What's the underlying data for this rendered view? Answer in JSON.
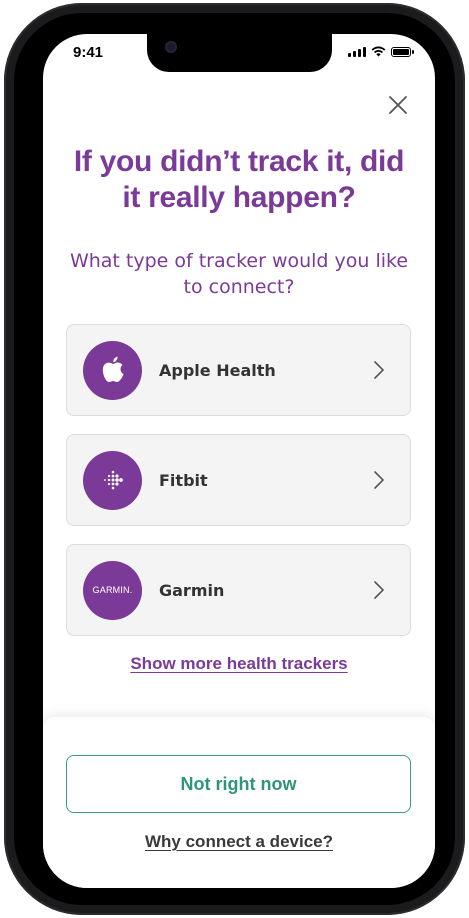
{
  "status_bar": {
    "time": "9:41"
  },
  "headline": "If you didn’t track it, did it really happen?",
  "subheadline": "What type of tracker would you like to connect?",
  "trackers": [
    {
      "name": "Apple Health",
      "icon": "apple-icon"
    },
    {
      "name": "Fitbit",
      "icon": "fitbit-icon"
    },
    {
      "name": "Garmin",
      "icon": "garmin-logo",
      "logo_text": "GARMIN."
    }
  ],
  "show_more_label": "Show more health trackers",
  "not_now_label": "Not right now",
  "why_connect_label": "Why connect a device?",
  "colors": {
    "brand_purple": "#7b3a97",
    "accent_green": "#2f9577",
    "card_bg": "#f4f4f4"
  }
}
